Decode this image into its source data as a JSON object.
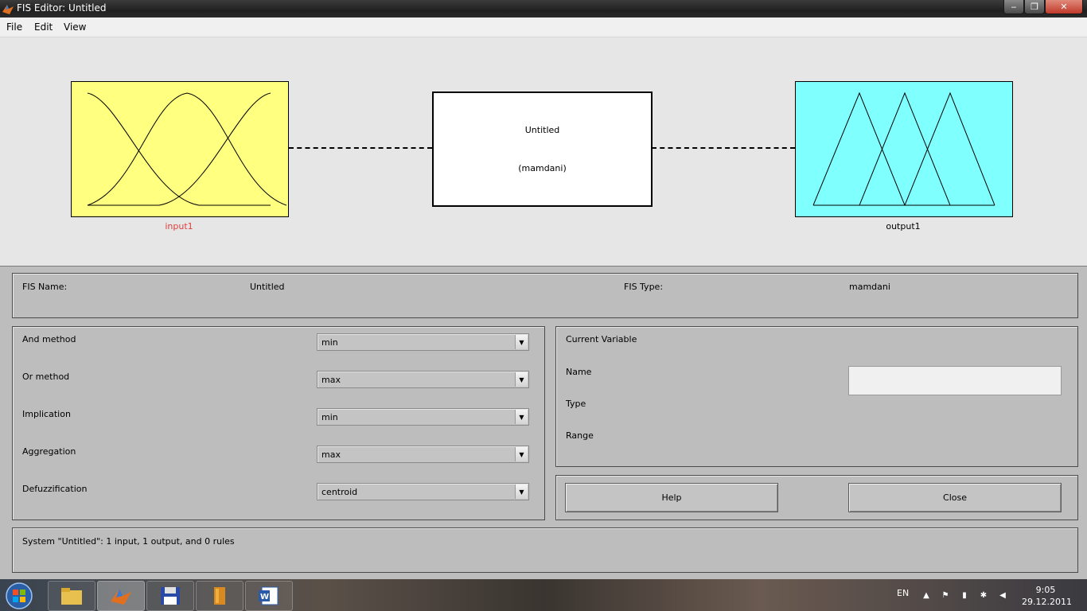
{
  "window": {
    "title": "FIS Editor: Untitled",
    "controls": {
      "minimize": "‒",
      "maximize": "❐",
      "close": "✕"
    }
  },
  "menu": [
    "File",
    "Edit",
    "View"
  ],
  "diagram": {
    "input_label": "input1",
    "output_label": "output1",
    "system_name": "Untitled",
    "system_type": "(mamdani)",
    "input_color": "#ffff80",
    "output_color": "#80ffff",
    "input_label_color": "#e04040"
  },
  "fis": {
    "name_label": "FIS Name:",
    "name_value": "Untitled",
    "type_label": "FIS Type:",
    "type_value": "mamdani"
  },
  "methods": [
    {
      "label": "And method",
      "value": "min"
    },
    {
      "label": "Or method",
      "value": "max"
    },
    {
      "label": "Implication",
      "value": "min"
    },
    {
      "label": "Aggregation",
      "value": "max"
    },
    {
      "label": "Defuzzification",
      "value": "centroid"
    }
  ],
  "current_variable": {
    "header": "Current Variable",
    "name_label": "Name",
    "type_label": "Type",
    "range_label": "Range",
    "name_value": ""
  },
  "buttons": {
    "help": "Help",
    "close": "Close"
  },
  "status": "System \"Untitled\": 1 input, 1 output, and 0 rules",
  "taskbar": {
    "language": "EN",
    "time": "9:05",
    "date": "29.12.2011"
  }
}
